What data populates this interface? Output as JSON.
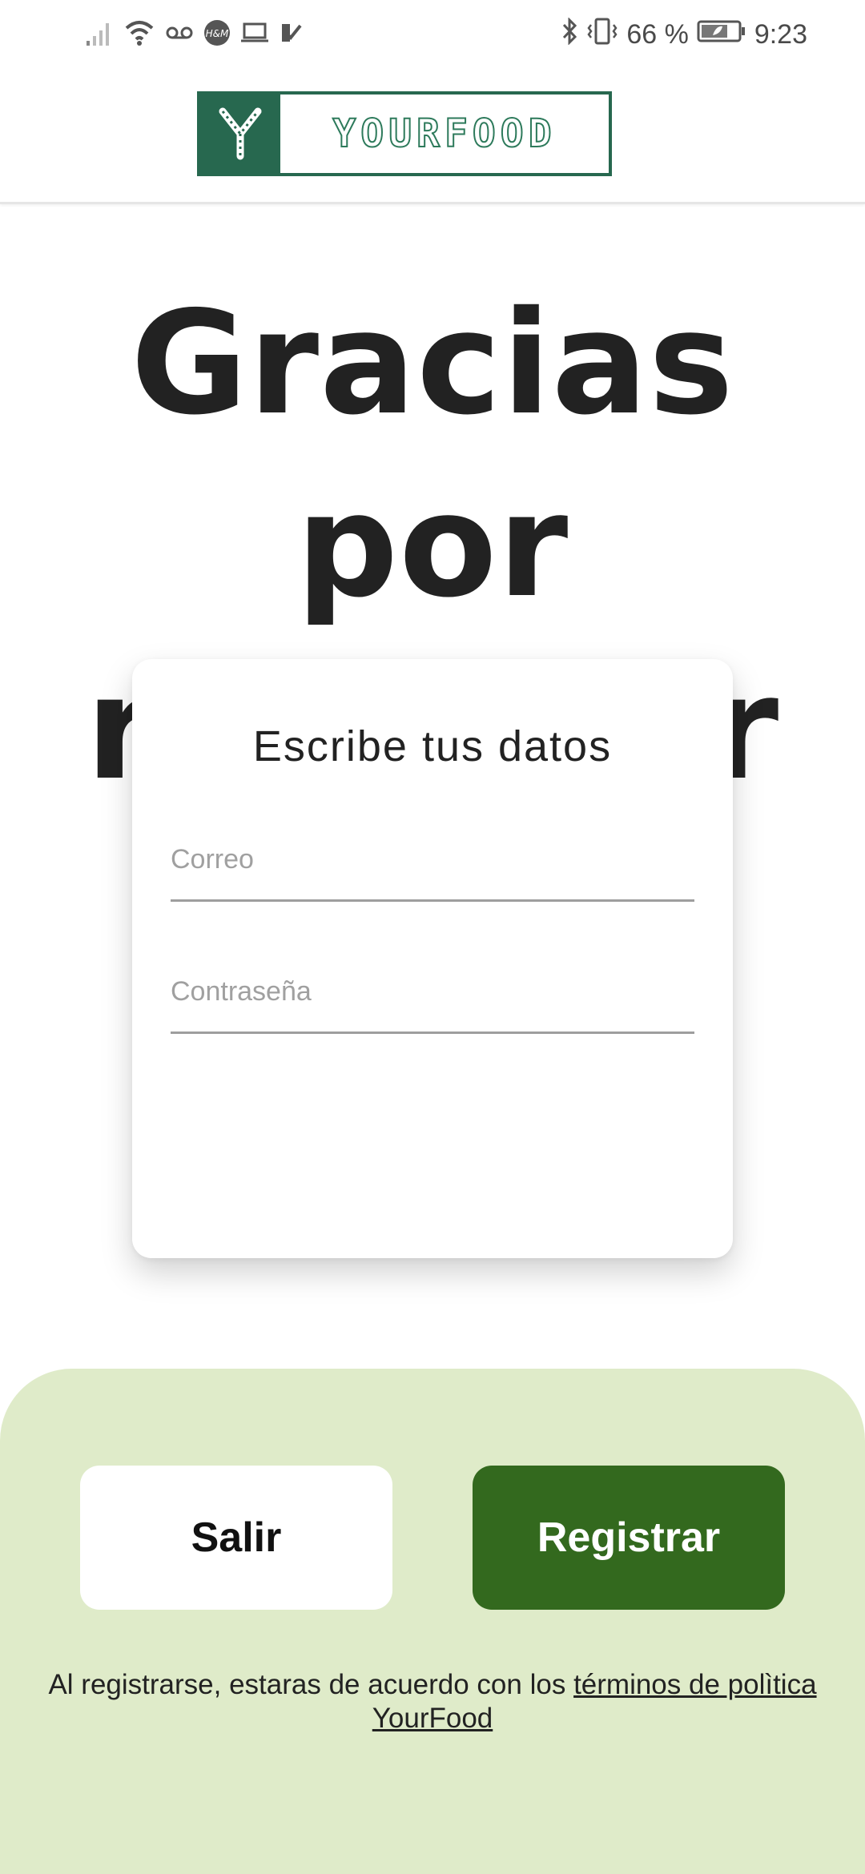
{
  "status_bar": {
    "battery_percent": "66 %",
    "time": "9:23",
    "icons": [
      "signal-icon",
      "wifi-icon",
      "voicemail-icon",
      "hm-app-icon",
      "laptop-icon",
      "task-check-icon",
      "bluetooth-icon",
      "vibrate-icon",
      "battery-icon"
    ]
  },
  "header": {
    "logo_text": "YOURFOOD",
    "brand_color": "#27684f"
  },
  "headline": {
    "line1": "Gracias por",
    "line2": "regresar"
  },
  "login_card": {
    "title": "Escribe tus datos",
    "email_placeholder": "Correo",
    "password_placeholder": "Contraseña"
  },
  "actions": {
    "exit_label": "Salir",
    "register_label": "Registrar",
    "register_color": "#33691e",
    "panel_color": "#dfebc9"
  },
  "terms": {
    "prefix": "Al registrarse, estaras de acuerdo con los ",
    "link_text": "términos de polìtica YourFood"
  }
}
